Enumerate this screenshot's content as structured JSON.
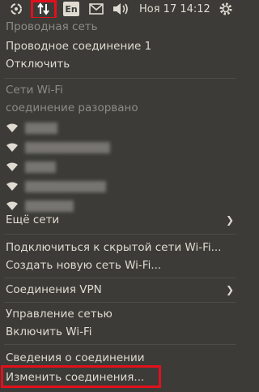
{
  "panel": {
    "keyboard_layout": "En",
    "datetime": "Ноя 17 14:12",
    "icons": [
      "ubuntu-settings-icon",
      "network-updown-icon",
      "keyboard-icon",
      "mail-icon",
      "volume-icon",
      "power-gear-icon"
    ],
    "highlight_color": "#e3101c"
  },
  "menu": {
    "wired_header": "Проводная сеть",
    "wired_connection": "Проводное соединение 1",
    "disconnect": "Отключить",
    "wifi_header": "Сети Wi-Fi",
    "wifi_status": "соединение разорвано",
    "wifi_networks_count_hidden": 5,
    "more_networks": "Ещё сети",
    "connect_hidden": "Подключиться к скрытой сети Wi-Fi...",
    "create_new": "Создать новую сеть Wi-Fi...",
    "vpn": "Соединения VPN",
    "manage_network": "Управление сетью",
    "enable_wifi": "Включить Wi-Fi",
    "connection_info": "Сведения о соединении",
    "edit_connections": "Изменить соединения..."
  }
}
